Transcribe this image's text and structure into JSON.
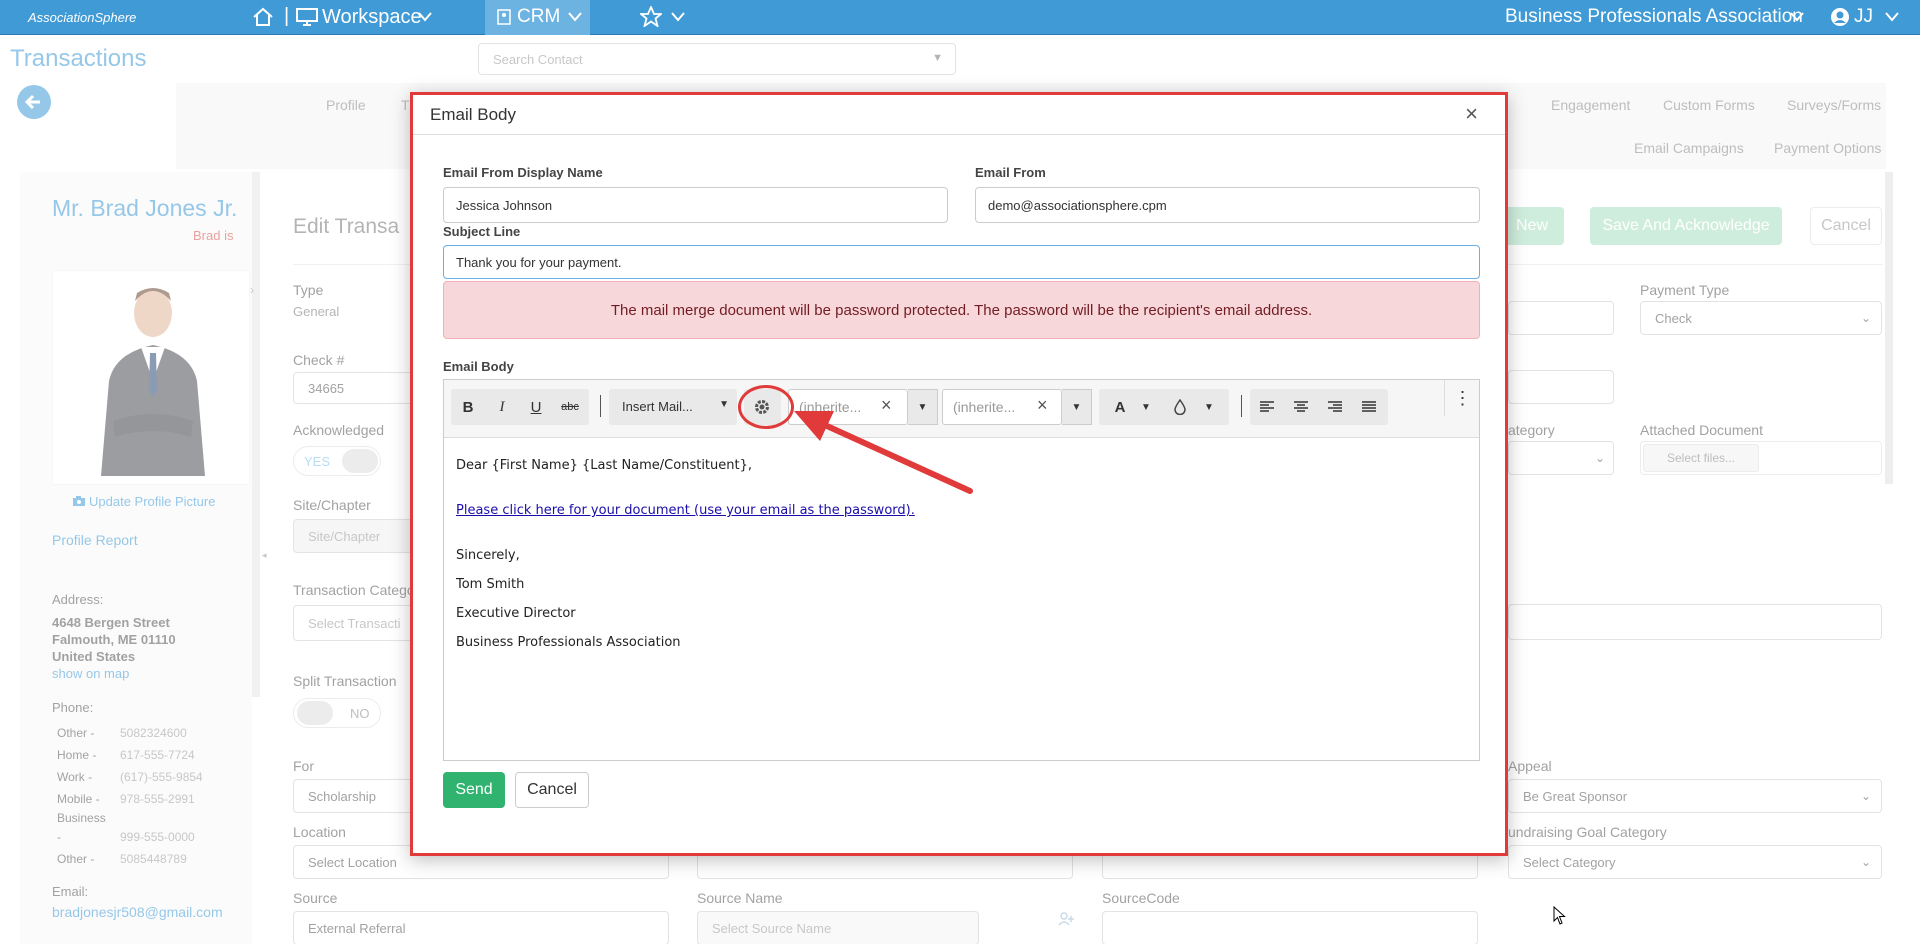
{
  "topbar": {
    "logo": "AssociationSphere",
    "workspace": "Workspace",
    "crm": "CRM",
    "org_name": "Business Professionals Association",
    "user": "JJ"
  },
  "search": {
    "placeholder": "Search Contact"
  },
  "page": {
    "title": "Transactions"
  },
  "subnav": {
    "items": [
      "Profile",
      "Engagement",
      "Custom Forms",
      "Surveys/Forms",
      "Email Campaigns",
      "Payment Options"
    ],
    "partial": "T"
  },
  "contact": {
    "name": "Mr. Brad Jones Jr.",
    "subtitle": "Brad is",
    "update_picture": "Update Profile Picture",
    "profile_report": "Profile Report",
    "address_label": "Address:",
    "address_lines": [
      "4648 Bergen Street",
      "Falmouth, ME 01110",
      "United States"
    ],
    "show_map": "show on map",
    "phone_label": "Phone:",
    "phones": [
      {
        "label": "Other -",
        "value": "5082324600"
      },
      {
        "label": "Home -",
        "value": "617-555-7724"
      },
      {
        "label": "Work -",
        "value": "(617)-555-9854"
      },
      {
        "label": "Mobile -",
        "value": "978-555-2991"
      },
      {
        "label": "Business",
        "value": ""
      },
      {
        "label": "-",
        "value": "999-555-0000"
      },
      {
        "label": "Other -",
        "value": "5085448789"
      }
    ],
    "email_label": "Email:",
    "email": "bradjonesjr508@gmail.com"
  },
  "form": {
    "edit_title": "Edit Transa",
    "type_label": "Type",
    "type_value": "General",
    "check_label": "Check #",
    "check_value": "34665",
    "ack_label": "Acknowledged",
    "ack_value": "YES",
    "site_label": "Site/Chapter",
    "site_value": "Site/Chapter",
    "tcat_label": "Transaction Catego",
    "tcat_value": "Select Transacti",
    "split_label": "Split Transaction",
    "split_value": "NO",
    "for_label": "For",
    "for_value": "Scholarship",
    "location_label": "Location",
    "location_value": "Select Location",
    "source_label": "Source",
    "source_value": "External Referral",
    "source_name_label": "Source Name",
    "source_name_value": "Select Source Name",
    "source_code_label": "SourceCode",
    "payment_type_label": "Payment Type",
    "payment_type_value": "Check",
    "category_label": "ategory",
    "attached_label": "Attached Document",
    "attached_value": "Select files...",
    "appeal_label": "Appeal",
    "appeal_value": "Be Great Sponsor",
    "fundraising_label": "undraising Goal Category",
    "fundraising_value": "Select Category",
    "new_btn": "New",
    "save_ack_btn": "Save And Acknowledge",
    "cancel_btn": "Cancel"
  },
  "modal": {
    "title": "Email Body",
    "from_name_label": "Email From Display Name",
    "from_name_value": "Jessica Johnson",
    "from_label": "Email From",
    "from_value": "demo@associationsphere.cpm",
    "subject_label": "Subject Line",
    "subject_value": "Thank you for your payment.",
    "alert": "The mail merge document will be password protected. The password will be the recipient's email address.",
    "body_label": "Email Body",
    "insert_mail": "Insert Mail...",
    "font_family": "(inherite...",
    "font_size": "(inherite...",
    "body_lines": [
      "Dear {First Name} {Last Name/Constituent},",
      "Please click here for your document (use your email as the password).",
      "Sincerely,",
      "Tom Smith",
      "Executive Director",
      "Business Professionals Association"
    ],
    "send": "Send",
    "cancel": "Cancel"
  },
  "colors": {
    "brand": "#3f9ad6",
    "highlight": "#e03a3a",
    "send": "#2fb36f",
    "alert_bg": "#f8d7da"
  }
}
